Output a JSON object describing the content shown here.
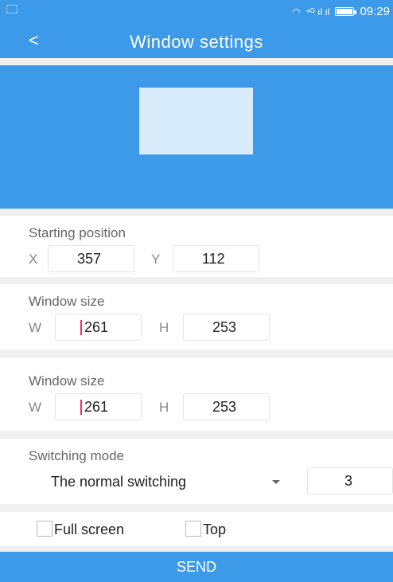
{
  "status_bar": {
    "time": "09:29",
    "signal_text": "⁴ᴳ ıl ıl"
  },
  "header": {
    "back_icon": "<",
    "title": "Window settings"
  },
  "starting_position": {
    "label": "Starting position",
    "x_label": "X",
    "x_value": "357",
    "y_label": "Y",
    "y_value": "112"
  },
  "window_size_1": {
    "label": "Window size",
    "w_label": "W",
    "w_value": "261",
    "h_label": "H",
    "h_value": "253"
  },
  "window_size_2": {
    "label": "Window size",
    "w_label": "W",
    "w_value": "261",
    "h_label": "H",
    "h_value": "253"
  },
  "switching_mode": {
    "label": "Switching mode",
    "selected": "The normal switching",
    "count": "3"
  },
  "options": {
    "full_screen": "Full screen",
    "top": "Top"
  },
  "send_label": "SEND",
  "colors": {
    "primary": "#3d9ae8",
    "preview_window": "#d9ecfb",
    "cursor": "#e8305b"
  }
}
